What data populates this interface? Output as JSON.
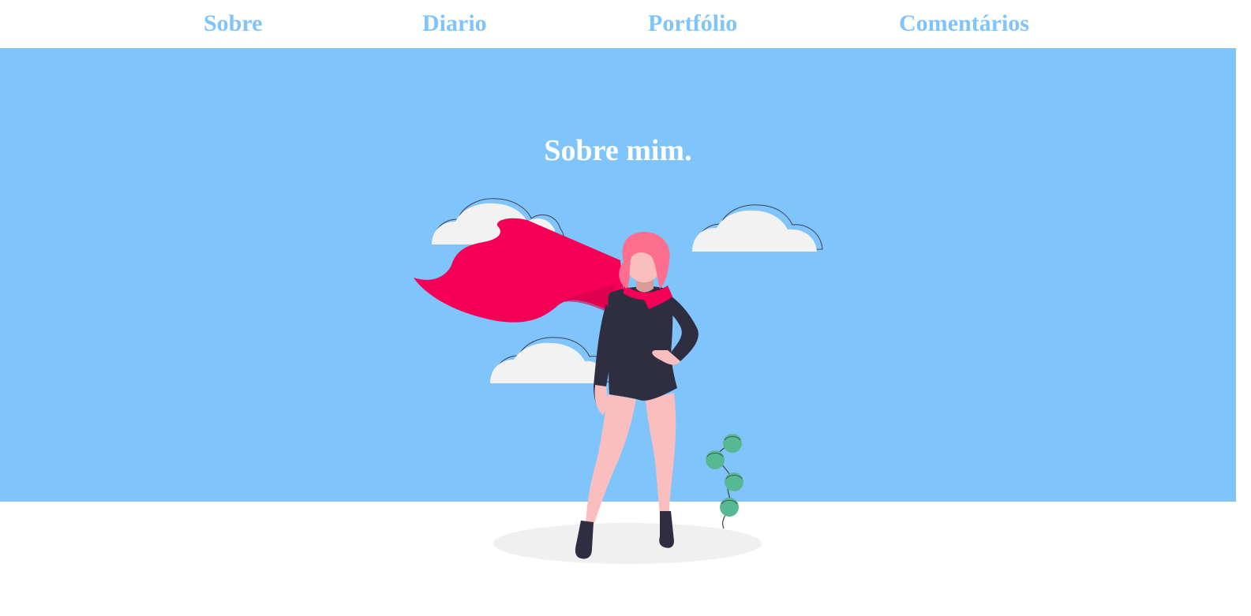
{
  "nav": {
    "items": [
      {
        "label": "Sobre"
      },
      {
        "label": "Diario"
      },
      {
        "label": "Portfólio"
      },
      {
        "label": "Comentários"
      }
    ]
  },
  "hero": {
    "title": "Sobre mim.",
    "illustration": "superhero-woman-with-cape-and-clouds"
  },
  "colors": {
    "accent": "#80c4fc",
    "cape": "#f50057",
    "hair": "#fe6e8e",
    "skin": "#fbbebe",
    "suit": "#2f2e41",
    "cloud": "#f2f2f2",
    "plant": "#57b894"
  }
}
